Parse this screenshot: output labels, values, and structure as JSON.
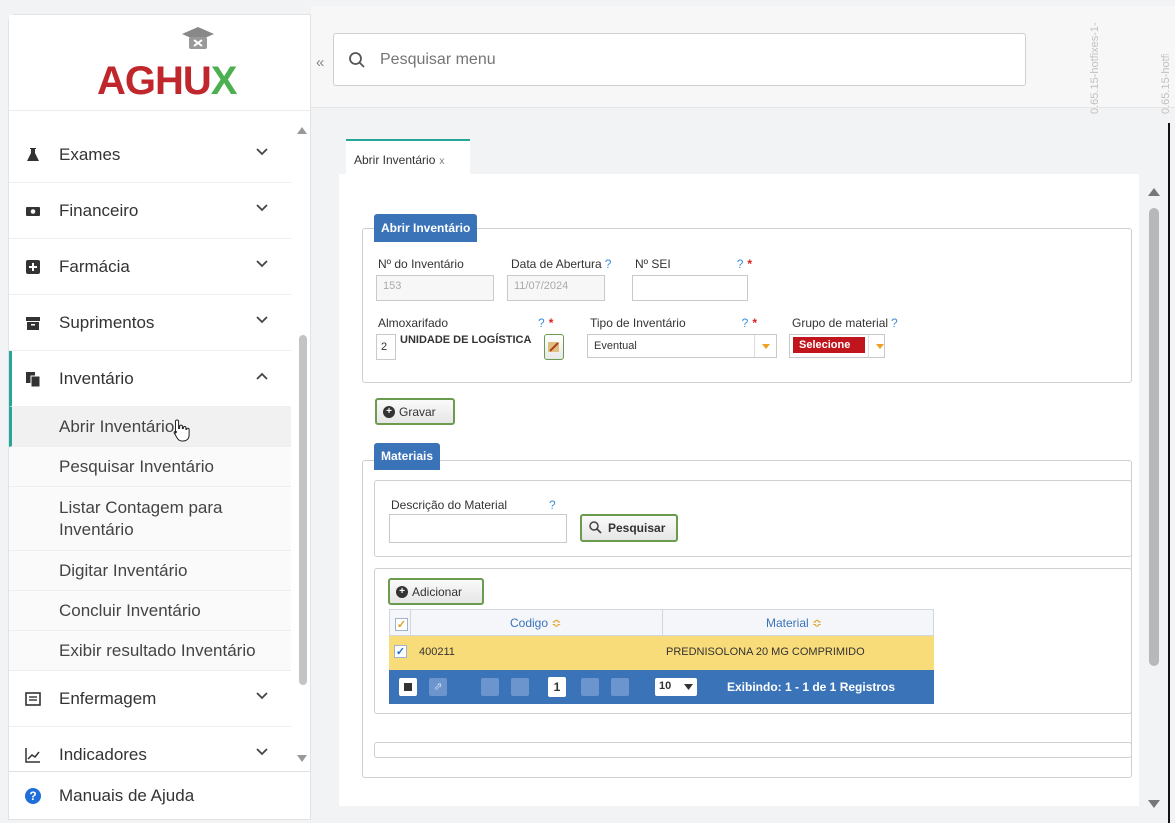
{
  "app": {
    "logo": "AGHU",
    "logo_accent": "X",
    "version": "0.65.15-hotfixes-1-"
  },
  "colors": {
    "brand_red": "#c0272d",
    "brand_green": "#4caf50",
    "accent_teal": "#26a69a",
    "panel_blue": "#3b73b9",
    "row_highlight": "#f9dc7a"
  },
  "search": {
    "placeholder": "Pesquisar menu"
  },
  "sidebar": {
    "items": [
      {
        "label": "Exames",
        "icon": "flask-icon"
      },
      {
        "label": "Financeiro",
        "icon": "money-icon"
      },
      {
        "label": "Farmácia",
        "icon": "plus-square-icon"
      },
      {
        "label": "Suprimentos",
        "icon": "archive-icon"
      },
      {
        "label": "Inventário",
        "icon": "copy-icon"
      }
    ],
    "sub_items": [
      {
        "label": "Abrir Inventário"
      },
      {
        "label": "Pesquisar Inventário"
      },
      {
        "label": "Listar Contagem para Inventário"
      },
      {
        "label": "Digitar Inventário"
      },
      {
        "label": "Concluir Inventário"
      },
      {
        "label": "Exibir resultado Inventário"
      }
    ],
    "after_items": [
      {
        "label": "Enfermagem",
        "icon": "list-icon"
      },
      {
        "label": "Indicadores",
        "icon": "chart-line-icon"
      }
    ],
    "footer": {
      "label": "Manuais de Ajuda",
      "icon": "help-icon"
    }
  },
  "tab": {
    "label": "Abrir Inventário",
    "close": "x"
  },
  "form": {
    "legend": "Abrir Inventário",
    "numero": {
      "label": "Nº do Inventário",
      "value": "153"
    },
    "data_abertura": {
      "label": "Data de Abertura",
      "help": "?",
      "value": "11/07/2024"
    },
    "sei": {
      "label": "Nº SEI",
      "help": "?",
      "required": "*",
      "value": ""
    },
    "almoxarifado": {
      "label": "Almoxarifado",
      "help": "?",
      "required": "*",
      "code": "2",
      "name": "UNIDADE DE LOGÍSTICA"
    },
    "tipo": {
      "label": "Tipo de Inventário",
      "help": "?",
      "required": "*",
      "value": "Eventual"
    },
    "grupo": {
      "label": "Grupo de material",
      "help": "?",
      "value": "Selecione"
    },
    "gravar": "Gravar"
  },
  "materiais": {
    "legend": "Materiais",
    "descricao": {
      "label": "Descrição do Material",
      "help": "?",
      "value": ""
    },
    "pesquisar": "Pesquisar",
    "adicionar": "Adicionar",
    "columns": {
      "codigo": "Codigo",
      "material": "Material",
      "sort": "≎"
    },
    "rows": [
      {
        "codigo": "400211",
        "material": "PREDNISOLONA 20 MG COMPRIMIDO",
        "checked": "✓"
      }
    ],
    "pager": {
      "page": "1",
      "per_page": "10",
      "info": "Exibindo: 1 - 1 de 1 Registros"
    }
  }
}
